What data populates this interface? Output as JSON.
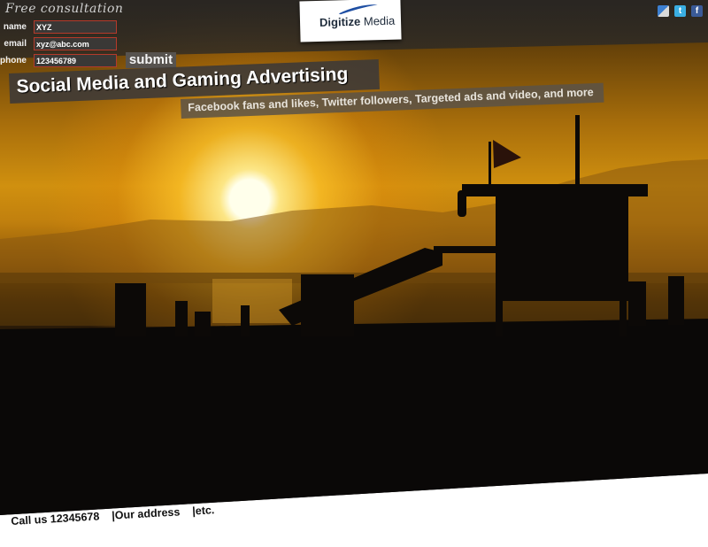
{
  "consultation": {
    "title": "Free consultation",
    "name_label": "name",
    "name_value": "XYZ",
    "email_label": "email",
    "email_value": "xyz@abc.com",
    "phone_label": "phone",
    "phone_value": "123456789",
    "submit_label": "submit"
  },
  "logo": {
    "brand_bold": "Digitize",
    "brand_rest": " Media"
  },
  "social": {
    "icons": [
      "delicious-icon",
      "twitter-icon",
      "facebook-icon"
    ],
    "twitter_glyph": "t",
    "facebook_glyph": "f"
  },
  "hero": {
    "headline": "Social Media and Gaming Advertising",
    "subheadline": "Facebook fans and likes, Twitter followers, Targeted ads and video, and more"
  },
  "footer": {
    "call": "Call us 12345678",
    "separator": "|",
    "address": "Our address",
    "etc": "etc."
  },
  "colors": {
    "input_border": "#b53a2b",
    "banner": "#3e3a36",
    "facebook": "#3a5a98",
    "twitter": "#3aaee3"
  }
}
